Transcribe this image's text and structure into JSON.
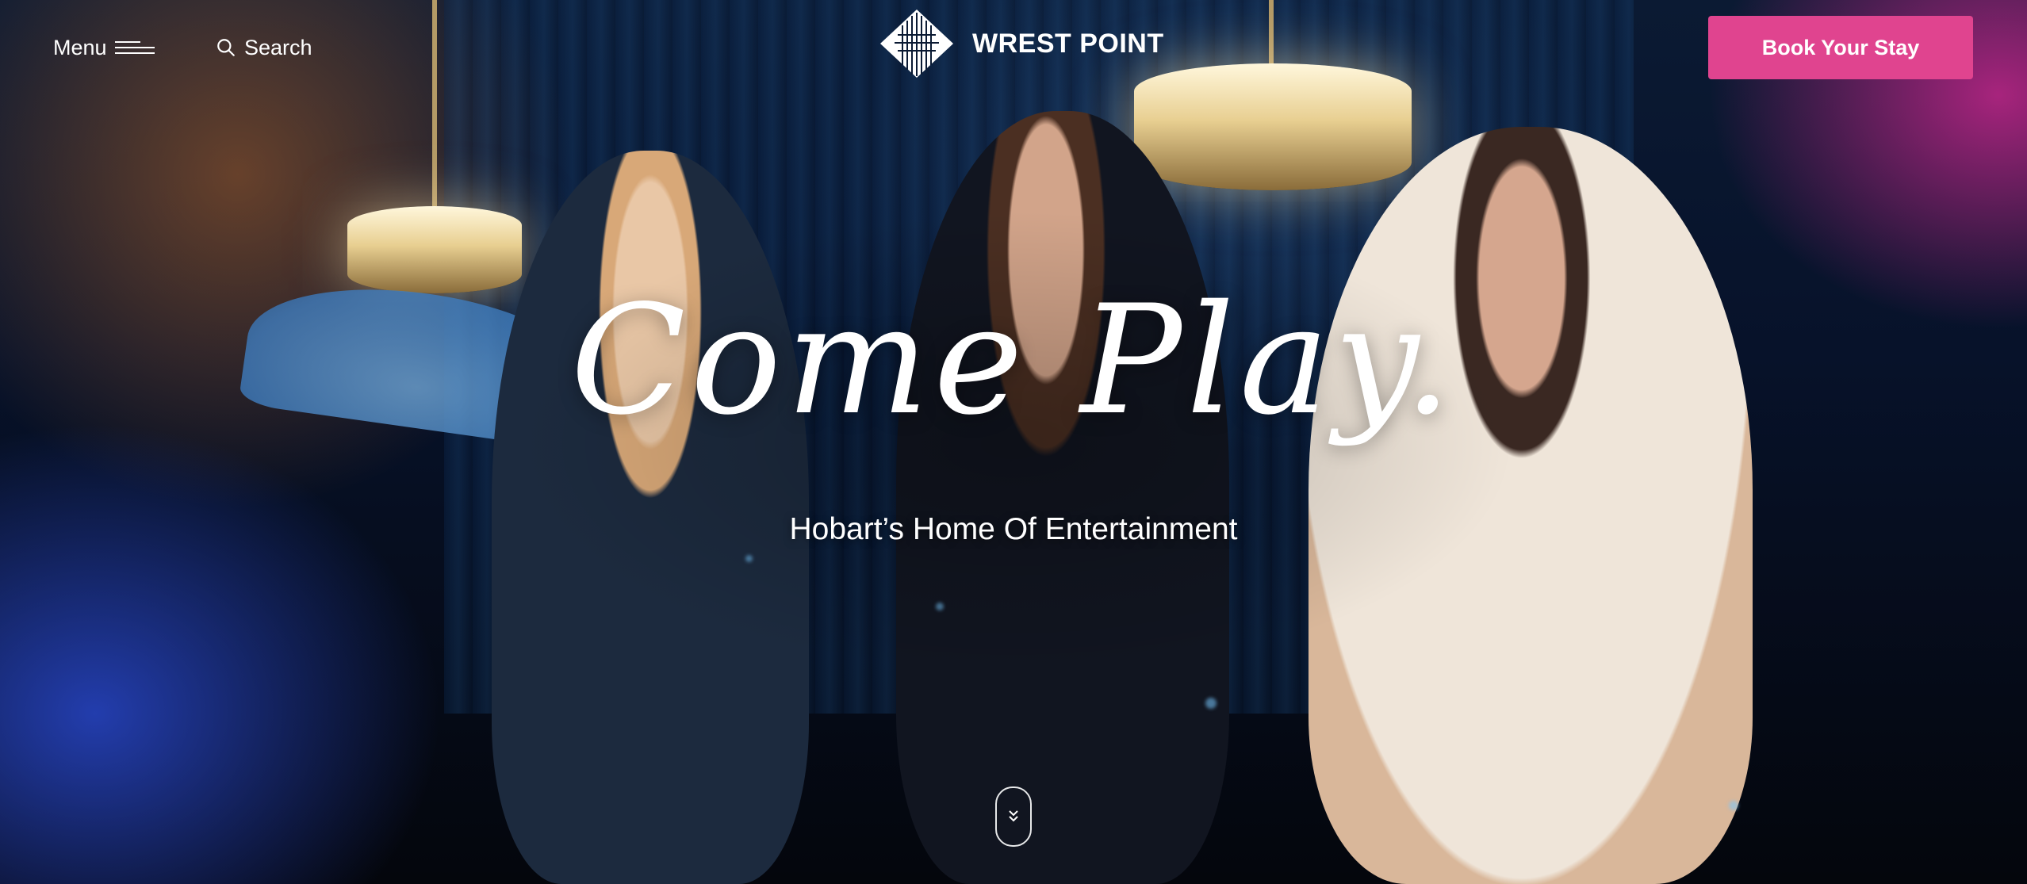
{
  "header": {
    "menu_label": "Menu",
    "search_label": "Search",
    "brand_name": "WREST POINT",
    "book_label": "Book Your Stay"
  },
  "hero": {
    "headline": "Come Play.",
    "subheadline": "Hobart’s Home Of Entertainment"
  },
  "icons": {
    "menu": "hamburger-menu-icon",
    "search": "search-icon",
    "logo": "wrest-point-logo",
    "scroll": "double-chevron-down-icon"
  },
  "colors": {
    "accent": "#e0448f",
    "text": "#ffffff"
  }
}
